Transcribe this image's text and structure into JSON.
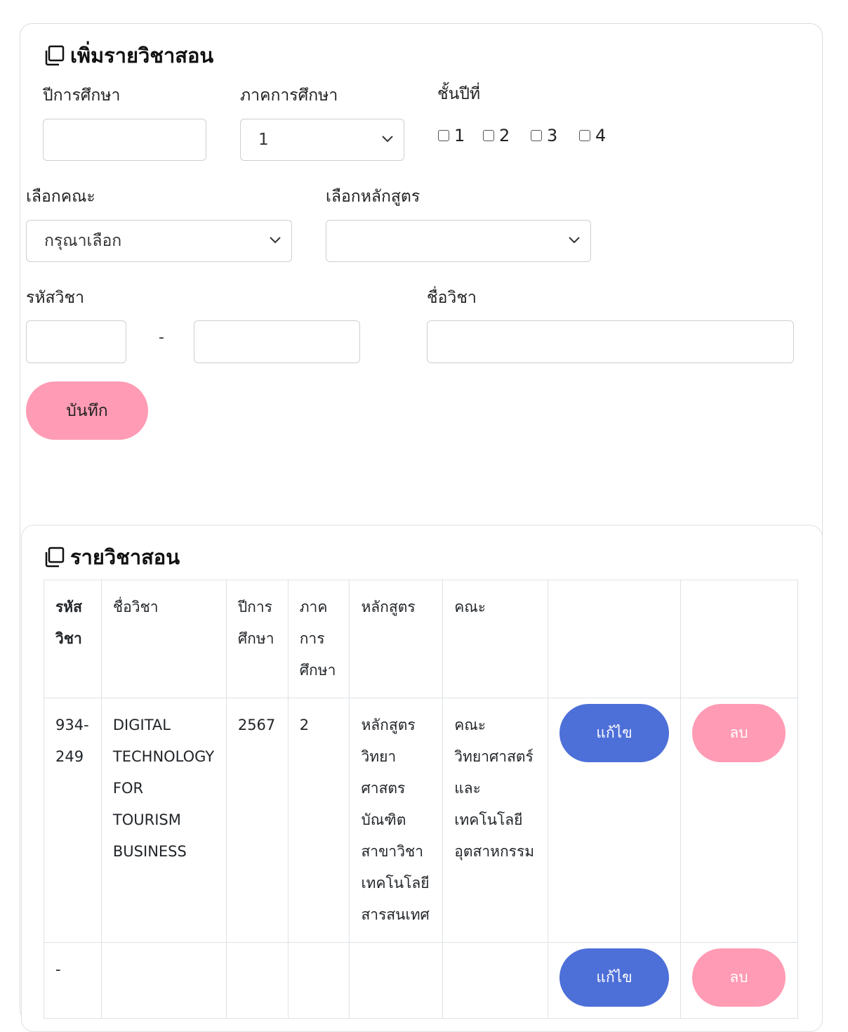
{
  "add_form": {
    "title": "เพิ่มรายวิชาสอน",
    "academic_year_label": "ปีการศึกษา",
    "academic_year_value": "",
    "semester_label": "ภาคการศึกษา",
    "semester_value": "1",
    "class_year_label": "ชั้นปีที่",
    "class_year_options": [
      "1",
      "2",
      "3",
      "4"
    ],
    "faculty_label": "เลือกคณะ",
    "faculty_value": "กรุณาเลือก",
    "curriculum_label": "เลือกหลักสูตร",
    "curriculum_value": "",
    "course_code_label": "รหัสวิชา",
    "course_code_separator": "-",
    "course_name_label": "ชื่อวิชา",
    "save_label": "บันทึก"
  },
  "course_list": {
    "title": "รายวิชาสอน",
    "headers": [
      "รหัสวิชา",
      "ชื่อวิชา",
      "ปีการศึกษา",
      "ภาคการศึกษา",
      "หลักสูตร",
      "คณะ",
      "",
      ""
    ],
    "rows": [
      {
        "code": "934-249",
        "name": "DIGITAL TECHNOLOGY FOR TOURISM BUSINESS",
        "year": "2567",
        "semester": "2",
        "curriculum": "หลักสูตรวิทยาศาสตรบัณฑิต สาขาวิชาเทคโนโลยีสารสนเทศ",
        "faculty": "คณะวิทยาศาสตร์และเทคโนโลยีอุตสาหกรรม",
        "edit": "แก้ไข",
        "delete": "ลบ"
      },
      {
        "code": "-",
        "name": "",
        "year": "",
        "semester": "",
        "curriculum": "",
        "faculty": "",
        "edit": "แก้ไข",
        "delete": "ลบ"
      }
    ]
  },
  "colors": {
    "save_button": "#ff9bb4",
    "edit_button": "#4d6fd8",
    "delete_button": "#ff9bb4"
  }
}
